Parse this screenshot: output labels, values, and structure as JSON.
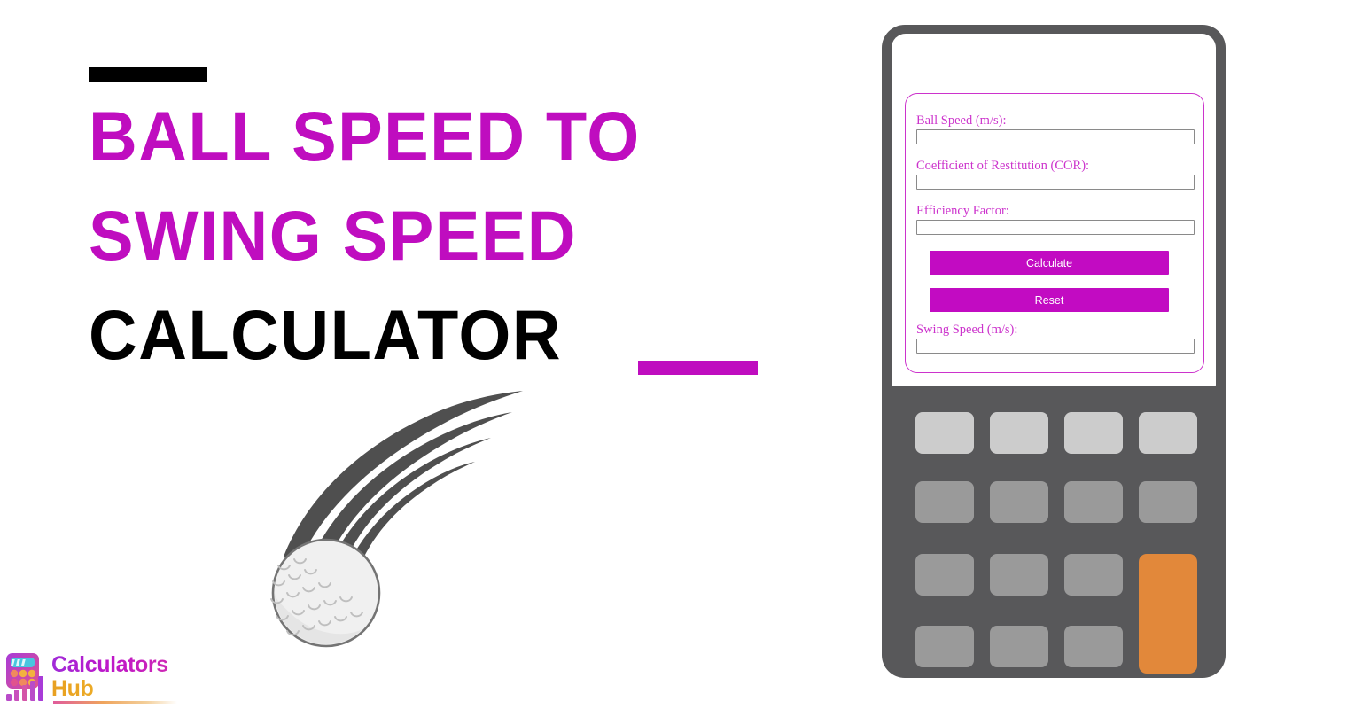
{
  "hero": {
    "title_lines": [
      {
        "text": "BALL SPEED TO",
        "color": "#BF0DBF"
      },
      {
        "text": "SWING SPEED",
        "color": "#BF0DBF"
      },
      {
        "text": "CALCULATOR",
        "color": "#000000"
      }
    ],
    "accent_bar_top_color": "#000000",
    "accent_bar_bottom_color": "#BF0DBF",
    "illustration": "golf-ball-with-motion-trail"
  },
  "logo": {
    "line1": "Calculators",
    "line2": "Hub",
    "mark": "calculator-bar-chart-icon",
    "color_line1": "#BE17C9",
    "color_line2": "#EFB32B"
  },
  "calculator": {
    "device_color": "#58585A",
    "screen_color": "#FFFFFF",
    "accent_color": "#C20BC2",
    "form": {
      "border_color": "#CC33CC",
      "fields": [
        {
          "label": "Ball Speed (m/s):",
          "value": "",
          "placeholder": ""
        },
        {
          "label": "Coefficient of Restitution (COR):",
          "value": "",
          "placeholder": ""
        },
        {
          "label": "Efficiency Factor:",
          "value": "",
          "placeholder": ""
        }
      ],
      "result": {
        "label": "Swing Speed (m/s):",
        "value": "",
        "placeholder": ""
      },
      "buttons": {
        "calculate": "Calculate",
        "reset": "Reset"
      }
    },
    "keypad": {
      "rows": 4,
      "cols": 4,
      "default_key_color": "#9A9A9A",
      "top_row_key_color": "#CCCCCC",
      "accent_key_color": "#E2883A"
    }
  }
}
